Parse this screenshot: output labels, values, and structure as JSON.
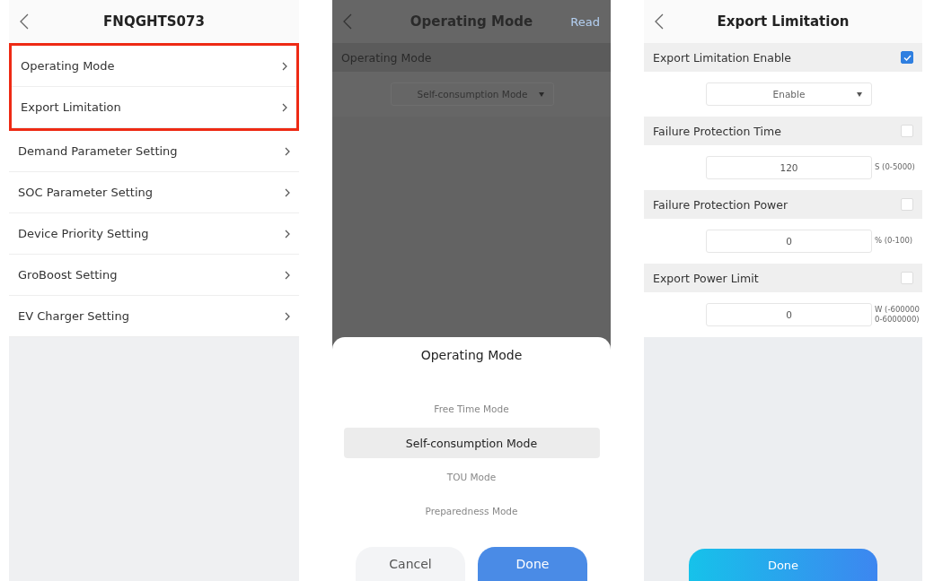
{
  "screens": [
    {
      "kind": "menu",
      "title": "FNQGHTS073",
      "items": [
        {
          "label": "Operating Mode",
          "highlighted": true
        },
        {
          "label": "Export Limitation",
          "highlighted": true
        },
        {
          "label": "Demand Parameter Setting",
          "highlighted": false
        },
        {
          "label": "SOC Parameter Setting",
          "highlighted": false
        },
        {
          "label": "Device Priority Setting",
          "highlighted": false
        },
        {
          "label": "GroBoost Setting",
          "highlighted": false
        },
        {
          "label": "EV Charger Setting",
          "highlighted": false
        }
      ]
    },
    {
      "kind": "picker",
      "title": "Operating Mode",
      "action": "Read",
      "section": "Operating Mode",
      "dropdown_value": "Self-consumption Mode",
      "sheet": {
        "title": "Operating Mode",
        "options": [
          {
            "label": "Free Time Mode",
            "selected": false
          },
          {
            "label": "Self-consumption Mode",
            "selected": true
          },
          {
            "label": "TOU Mode",
            "selected": false
          },
          {
            "label": "Preparedness Mode",
            "selected": false
          }
        ],
        "cancel": "Cancel",
        "done": "Done"
      }
    },
    {
      "kind": "form",
      "title": "Export Limitation",
      "fields": [
        {
          "label": "Export Limitation Enable",
          "checked": true,
          "kind": "select",
          "value": "Enable"
        },
        {
          "label": "Failure Protection Time",
          "checked": false,
          "kind": "number",
          "value": "120",
          "unit": "S (0-5000)"
        },
        {
          "label": "Failure Protection Power",
          "checked": false,
          "kind": "number",
          "value": "0",
          "unit": "% (0-100)"
        },
        {
          "label": "Export Power Limit",
          "checked": false,
          "kind": "number",
          "value": "0",
          "unit": "W (-600000 0-6000000)"
        }
      ],
      "button": "Done"
    }
  ]
}
